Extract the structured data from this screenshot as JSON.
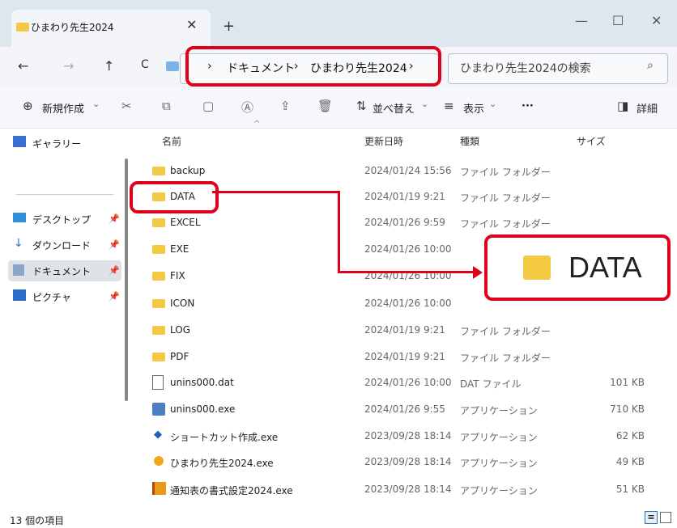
{
  "window": {
    "tab_title": "ひまわり先生2024",
    "tab_close": "✕",
    "tab_add": "+",
    "minimize": "—",
    "maximize": "☐",
    "close": "✕"
  },
  "nav": {
    "back": "←",
    "forward": "→",
    "up": "↑",
    "refresh": "C",
    "breadcrumb": [
      "ドキュメント",
      "ひまわり先生2024"
    ],
    "separator": "›"
  },
  "search": {
    "placeholder": "ひまわり先生2024の検索",
    "icon": "⌕"
  },
  "toolbar": {
    "new_label": "新規作成",
    "sort_label": "並べ替え",
    "view_label": "表示",
    "more_label": "···",
    "details_label": "詳細"
  },
  "sidebar": {
    "items": [
      {
        "label": "ギャラリー"
      },
      {
        "label": "デスクトップ"
      },
      {
        "label": "ダウンロード"
      },
      {
        "label": "ドキュメント"
      },
      {
        "label": "ピクチャ"
      }
    ]
  },
  "columns": {
    "name": "名前",
    "date": "更新日時",
    "type": "種類",
    "size": "サイズ"
  },
  "files": [
    {
      "name": "backup",
      "date": "2024/01/24 15:56",
      "type": "ファイル フォルダー",
      "size": ""
    },
    {
      "name": "DATA",
      "date": "2024/01/19 9:21",
      "type": "ファイル フォルダー",
      "size": ""
    },
    {
      "name": "EXCEL",
      "date": "2024/01/26 9:59",
      "type": "ファイル フォルダー",
      "size": ""
    },
    {
      "name": "EXE",
      "date": "2024/01/26 10:00",
      "type": "",
      "size": ""
    },
    {
      "name": "FIX",
      "date": "2024/01/26 10:00",
      "type": "",
      "size": ""
    },
    {
      "name": "ICON",
      "date": "2024/01/26 10:00",
      "type": "",
      "size": ""
    },
    {
      "name": "LOG",
      "date": "2024/01/19 9:21",
      "type": "ファイル フォルダー",
      "size": ""
    },
    {
      "name": "PDF",
      "date": "2024/01/19 9:21",
      "type": "ファイル フォルダー",
      "size": ""
    },
    {
      "name": "unins000.dat",
      "date": "2024/01/26 10:00",
      "type": "DAT ファイル",
      "size": "101 KB"
    },
    {
      "name": "unins000.exe",
      "date": "2024/01/26 9:55",
      "type": "アプリケーション",
      "size": "710 KB"
    },
    {
      "name": "ショートカット作成.exe",
      "date": "2023/09/28 18:14",
      "type": "アプリケーション",
      "size": "62 KB"
    },
    {
      "name": "ひまわり先生2024.exe",
      "date": "2023/09/28 18:14",
      "type": "アプリケーション",
      "size": "49 KB"
    },
    {
      "name": "通知表の書式設定2024.exe",
      "date": "2023/09/28 18:14",
      "type": "アプリケーション",
      "size": "51 KB"
    }
  ],
  "callout": {
    "label": "DATA"
  },
  "status": {
    "count": "13 個の項目"
  }
}
